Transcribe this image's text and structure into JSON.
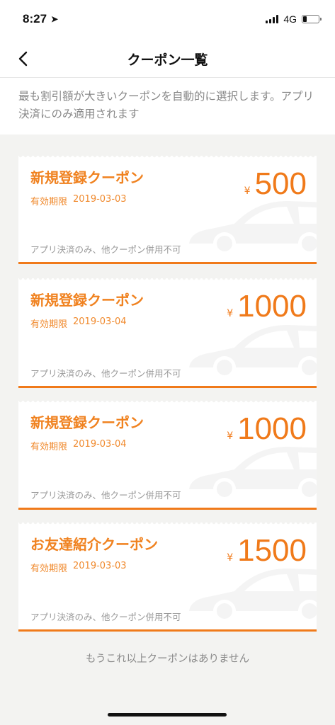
{
  "status": {
    "time": "8:27",
    "network": "4G"
  },
  "nav": {
    "title": "クーポン一覧"
  },
  "description": "最も割引額が大きいクーポンを自動的に選択します。アプリ決済にのみ適用されます",
  "coupons": [
    {
      "title": "新規登録クーポン",
      "expiry_label": "有効期限",
      "expiry_date": "2019-03-03",
      "currency": "¥",
      "amount": "500",
      "note": "アプリ決済のみ、他クーポン併用不可"
    },
    {
      "title": "新規登録クーポン",
      "expiry_label": "有効期限",
      "expiry_date": "2019-03-04",
      "currency": "¥",
      "amount": "1000",
      "note": "アプリ決済のみ、他クーポン併用不可"
    },
    {
      "title": "新規登録クーポン",
      "expiry_label": "有効期限",
      "expiry_date": "2019-03-04",
      "currency": "¥",
      "amount": "1000",
      "note": "アプリ決済のみ、他クーポン併用不可"
    },
    {
      "title": "お友達紹介クーポン",
      "expiry_label": "有効期限",
      "expiry_date": "2019-03-03",
      "currency": "¥",
      "amount": "1500",
      "note": "アプリ決済のみ、他クーポン併用不可"
    }
  ],
  "footer": "もうこれ以上クーポンはありません",
  "colors": {
    "accent": "#f07a1a",
    "background": "#f3f3f1"
  }
}
